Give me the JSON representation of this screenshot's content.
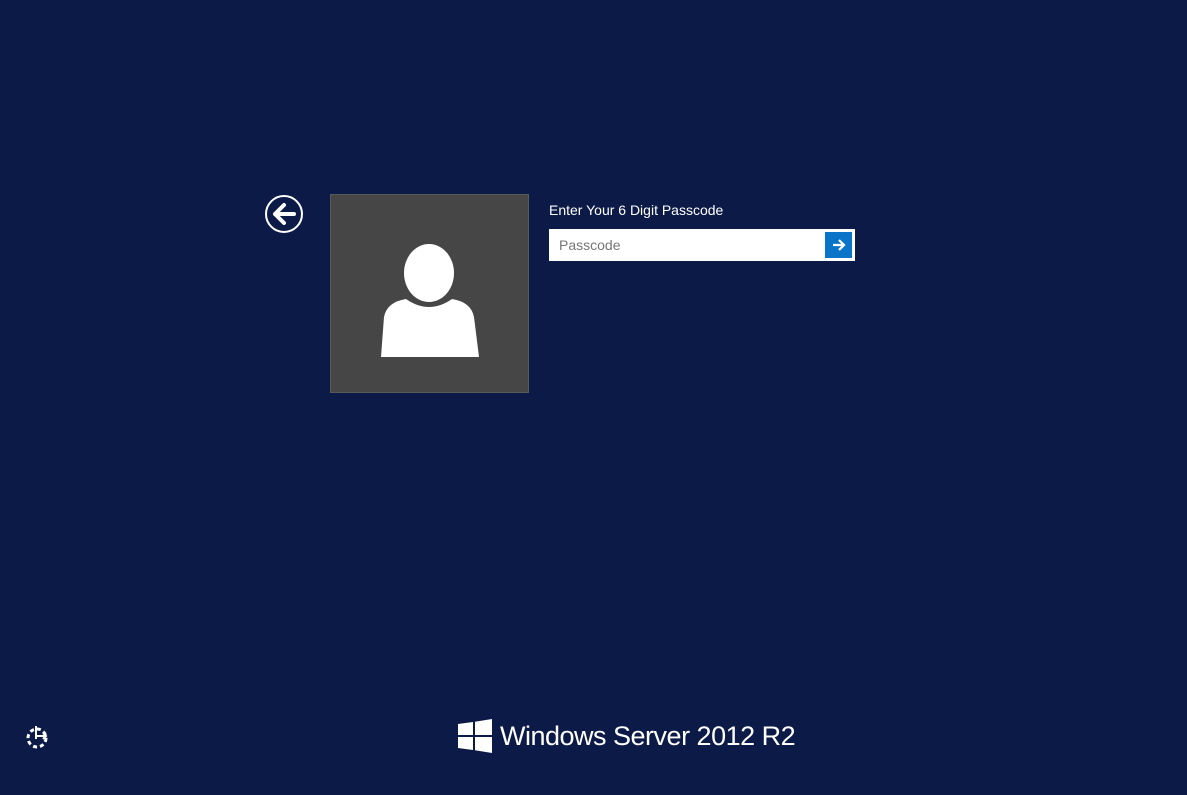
{
  "login": {
    "prompt": "Enter Your 6 Digit Passcode",
    "passcode_value": "",
    "passcode_placeholder": "Passcode"
  },
  "branding": {
    "product": "Windows Server 2012 R2"
  },
  "colors": {
    "background": "#0b1a47",
    "accent": "#0a74c8",
    "tile": "#464646"
  }
}
